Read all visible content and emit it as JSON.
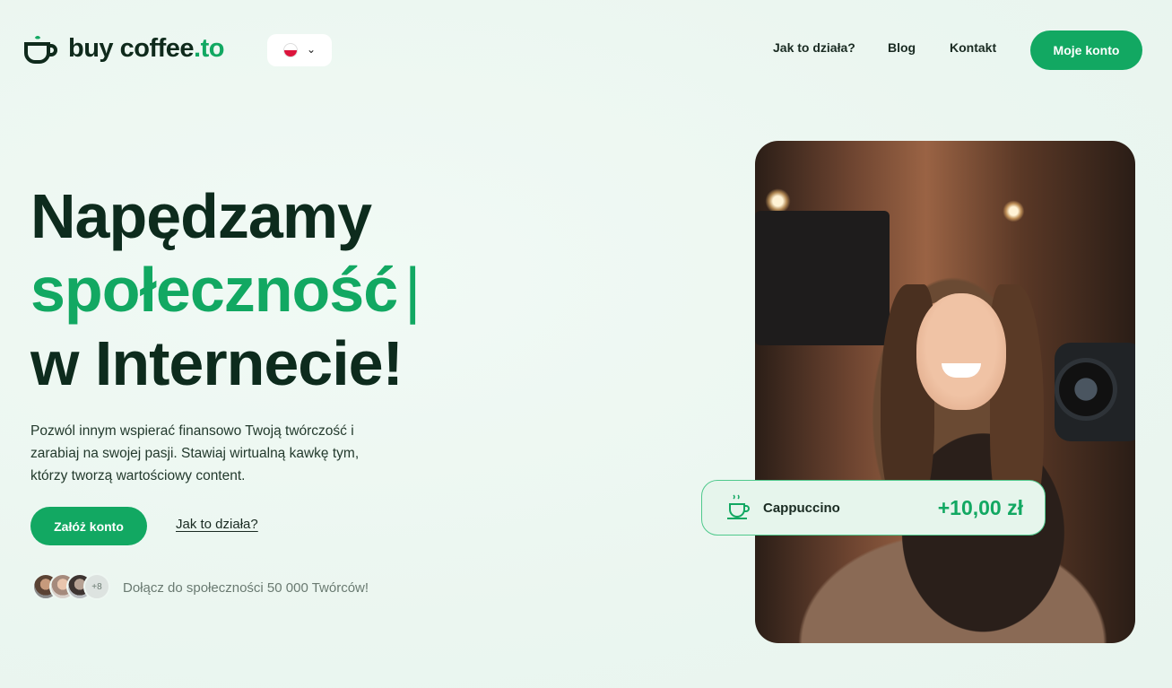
{
  "brand": {
    "name": "buy coffee",
    "tld": ".to"
  },
  "language": {
    "selected": "PL",
    "icon": "chevron-down-icon"
  },
  "nav": {
    "items": [
      {
        "label": "Jak to działa?"
      },
      {
        "label": "Blog"
      },
      {
        "label": "Kontakt"
      }
    ],
    "account_label": "Moje konto"
  },
  "hero": {
    "line1": "Napędzamy",
    "line2": "społeczność",
    "cursor": "|",
    "line3": "w Internecie!",
    "lead": "Pozwól innym wspierać finansowo Twoją twórczość i zarabiaj na swojej pasji. Stawiaj wirtualną kawkę tym, którzy tworzą wartościowy content.",
    "cta_label": "Załóż konto",
    "how_label": "Jak to działa?",
    "avatars_more": "+8",
    "join_text": "Dołącz do społeczności 50 000 Twórców!"
  },
  "tip_card": {
    "icon": "coffee-cup-icon",
    "item": "Cappuccino",
    "amount": "+10,00 zł"
  },
  "colors": {
    "accent": "#12a862",
    "dark": "#0d2b1d",
    "background": "#eef7f2"
  }
}
